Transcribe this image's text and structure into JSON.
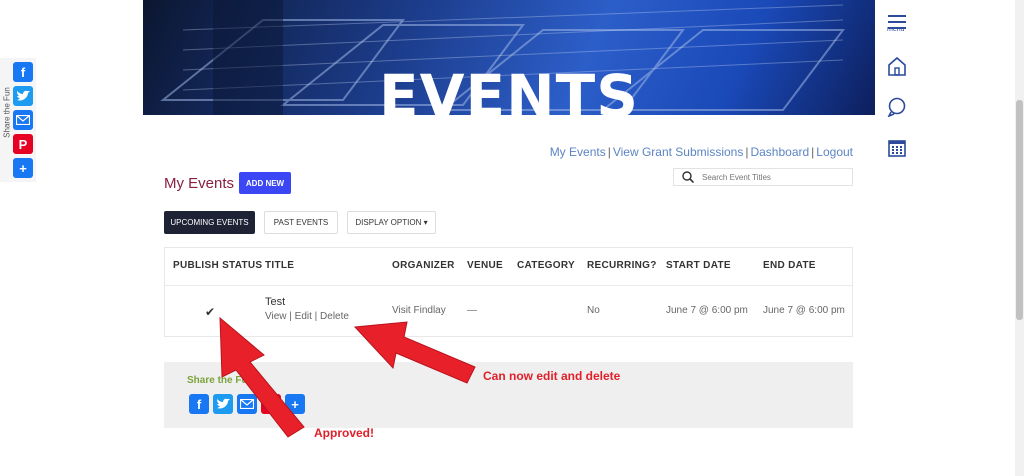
{
  "hero": {
    "title": "EVENTS"
  },
  "rail": {
    "menu_label": "menu",
    "icons": [
      "menu-icon",
      "home-icon",
      "chat-icon",
      "calendar-icon"
    ]
  },
  "sharebar": {
    "label": "Share the Fun"
  },
  "nav": {
    "links": [
      "My Events",
      "View Grant Submissions",
      "Dashboard",
      "Logout"
    ],
    "separator": "|"
  },
  "page": {
    "heading": "My Events",
    "add_new": "ADD NEW",
    "search_placeholder": "Search Event Titles"
  },
  "tabs": {
    "upcoming": "UPCOMING EVENTS",
    "past": "PAST EVENTS",
    "display": "DISPLAY OPTION ▾"
  },
  "table": {
    "headers": [
      "PUBLISH STATUS",
      "TITLE",
      "ORGANIZER",
      "VENUE",
      "CATEGORY",
      "RECURRING?",
      "START DATE",
      "END DATE"
    ],
    "rows": [
      {
        "status": "✔",
        "title": "Test",
        "actions": [
          "View",
          "Edit",
          "Delete"
        ],
        "organizer": "Visit Findlay",
        "venue": "—",
        "category": "",
        "recurring": "No",
        "start": "June 7 @ 6:00 pm",
        "end": "June 7 @ 6:00 pm"
      }
    ]
  },
  "share_box": {
    "label": "Share the Fun"
  },
  "annotations": {
    "edit_delete": "Can now edit and delete",
    "approved": "Approved!"
  },
  "colors": {
    "accent_blue": "#3b47f5",
    "link_blue": "#5b84c4",
    "heading_maroon": "#8b1e3f",
    "annotation_red": "#e0202a"
  }
}
